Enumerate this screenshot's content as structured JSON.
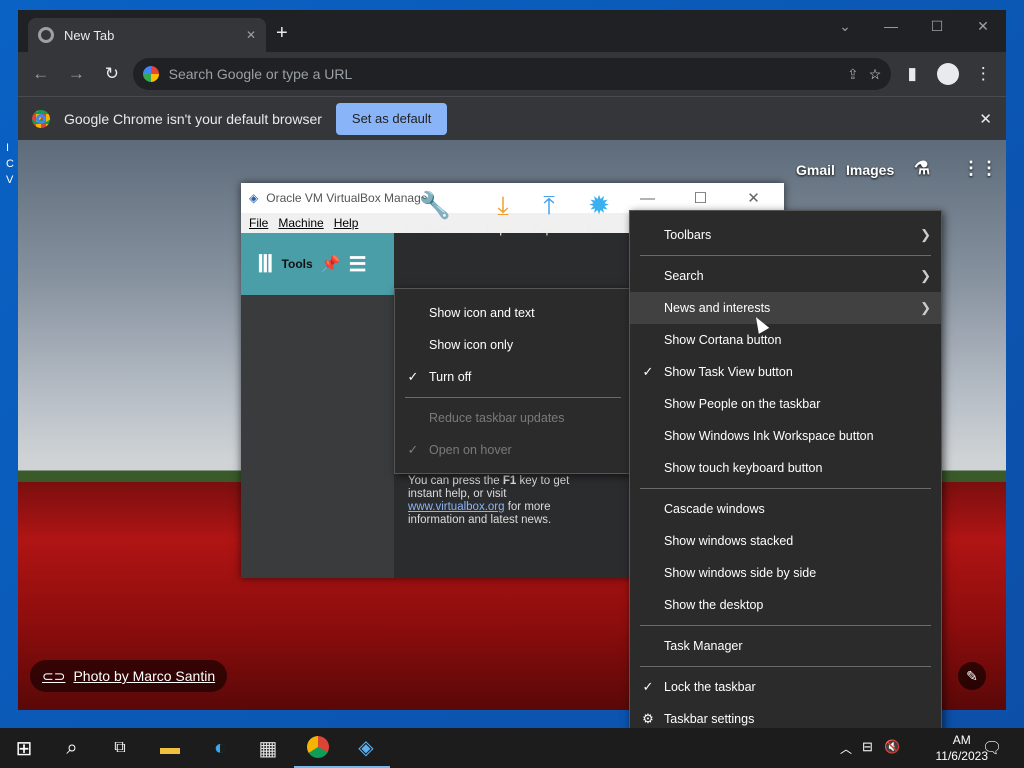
{
  "desktop": {
    "icon_letters": [
      "I",
      "C",
      "V"
    ]
  },
  "chrome": {
    "tab_title": "New Tab",
    "new_tab": "+",
    "omnibox_placeholder": "Search Google or type a URL",
    "infobar_message": "Google Chrome isn't your default browser",
    "set_default_label": "Set as default",
    "gmail": "Gmail",
    "images": "Images",
    "photo_credit": "Photo by Marco Santin"
  },
  "virtualbox": {
    "title": "Oracle VM VirtualBox Manager",
    "menu": [
      "File",
      "Machine",
      "Help"
    ],
    "tools_label": "Tools",
    "toolbar": [
      "Preferences",
      "Import",
      "Export",
      "New"
    ],
    "help_text_1": "You can press the ",
    "help_key": "F1",
    "help_text_2": " key to get instant help, or visit ",
    "help_link": "www.virtualbox.org",
    "help_text_3": " for more information and latest news."
  },
  "submenu": {
    "items": [
      {
        "label": "Show icon and text",
        "checked": false,
        "disabled": false
      },
      {
        "label": "Show icon only",
        "checked": false,
        "disabled": false
      },
      {
        "label": "Turn off",
        "checked": true,
        "disabled": false
      },
      {
        "label": "Reduce taskbar updates",
        "checked": false,
        "disabled": true
      },
      {
        "label": "Open on hover",
        "checked": true,
        "disabled": true
      }
    ]
  },
  "context_menu": {
    "items": [
      {
        "label": "Toolbars"
      },
      {
        "label": "Search"
      },
      {
        "label": "News and interests"
      },
      {
        "label": "Show Cortana button"
      },
      {
        "label": "Show Task View button"
      },
      {
        "label": "Show People on the taskbar"
      },
      {
        "label": "Show Windows Ink Workspace button"
      },
      {
        "label": "Show touch keyboard button"
      },
      {
        "label": "Cascade windows"
      },
      {
        "label": "Show windows stacked"
      },
      {
        "label": "Show windows side by side"
      },
      {
        "label": "Show the desktop"
      },
      {
        "label": "Task Manager"
      },
      {
        "label": "Lock the taskbar"
      },
      {
        "label": "Taskbar settings"
      }
    ]
  },
  "taskbar": {
    "time": "AM",
    "date": "11/6/2023"
  },
  "colors": {
    "accent": "#8ab4f8",
    "vbox_tools": "#4a9ea8",
    "menu_bg": "#2b2b2b"
  }
}
